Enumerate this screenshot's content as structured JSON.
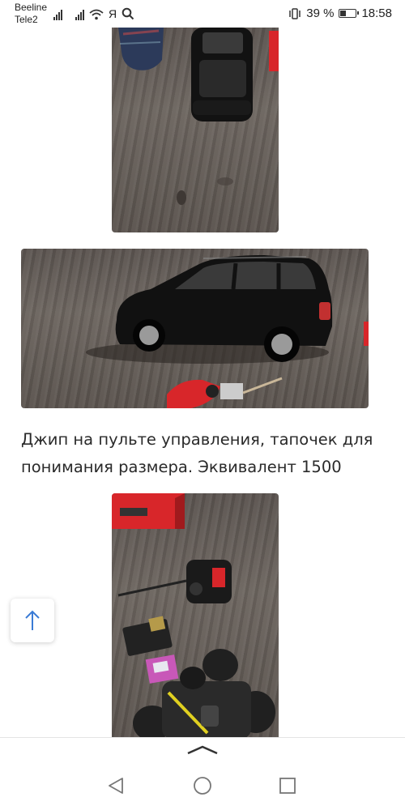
{
  "status_bar": {
    "carrier_1": "Beeline",
    "carrier_2": "Tele2",
    "keyboard_indicator": "Я",
    "battery_percent": "39 %",
    "battery_level": 0.39,
    "time": "18:58"
  },
  "content": {
    "caption": "Джип на пульте управления, тапочек для понимания размера. Эквивалент 1500"
  },
  "icons": {
    "scroll_top": "arrow-up-icon",
    "nav_back": "triangle-back-icon",
    "nav_home": "circle-home-icon",
    "nav_recents": "square-recents-icon",
    "sheet_handle": "chevron-up-icon"
  },
  "colors": {
    "accent_blue": "#3a7bd5",
    "car_body": "#121212",
    "toy_red": "#d8262a"
  }
}
